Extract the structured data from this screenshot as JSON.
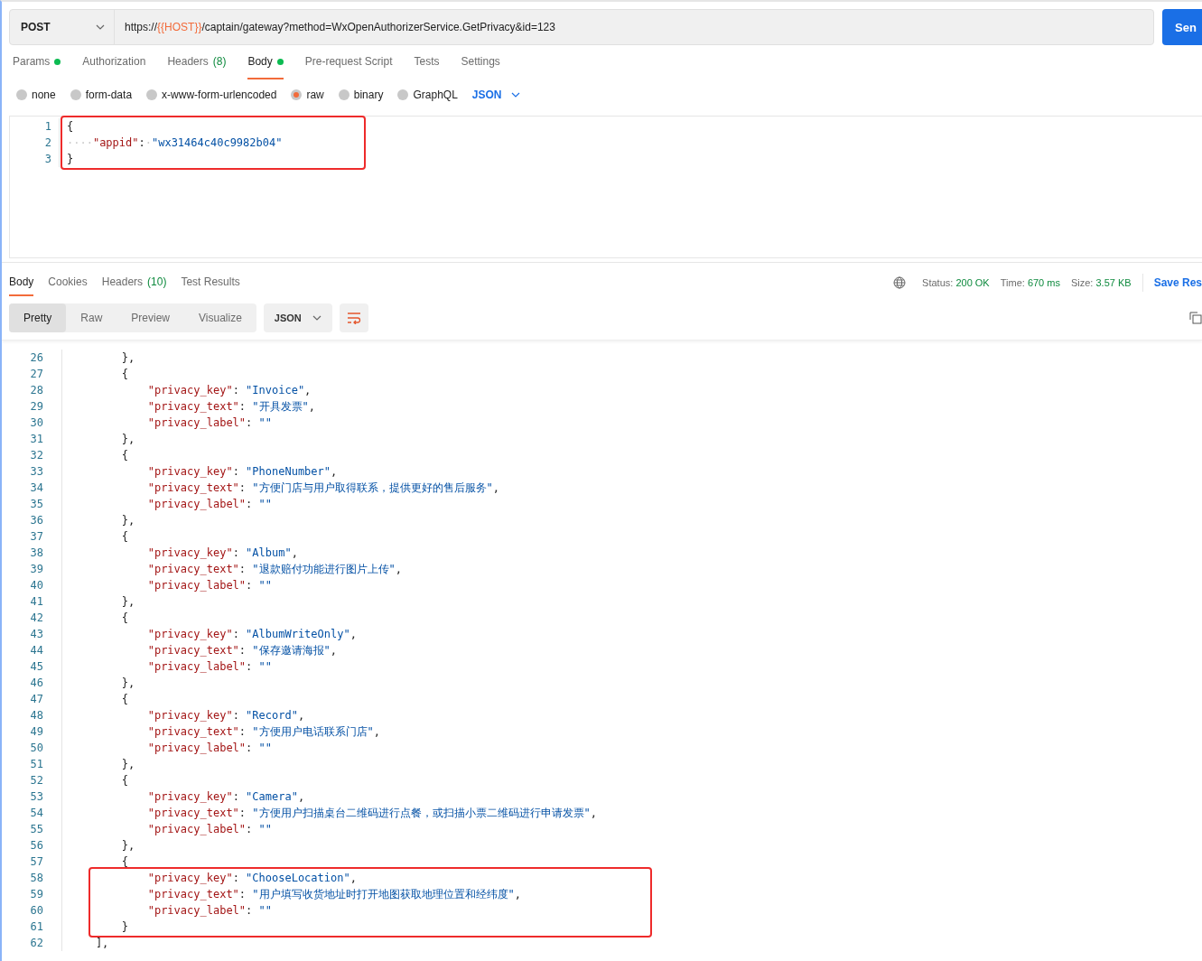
{
  "request": {
    "method": "POST",
    "url_parts": [
      {
        "kind": "plain",
        "text": "https://"
      },
      {
        "kind": "variable",
        "text": "{{HOST}}"
      },
      {
        "kind": "plain",
        "text": "/captain/gateway?method=WxOpenAuthorizerService.GetPrivacy&id=123"
      }
    ],
    "send_label": "Sen"
  },
  "request_tabs": [
    {
      "label": "Params",
      "dot": true,
      "selected": false
    },
    {
      "label": "Authorization",
      "dot": false,
      "selected": false
    },
    {
      "label": "Headers",
      "count": "(8)",
      "dot": false,
      "selected": false
    },
    {
      "label": "Body",
      "dot": true,
      "selected": true
    },
    {
      "label": "Pre-request Script",
      "dot": false,
      "selected": false
    },
    {
      "label": "Tests",
      "dot": false,
      "selected": false
    },
    {
      "label": "Settings",
      "dot": false,
      "selected": false
    }
  ],
  "body_types": [
    {
      "label": "none",
      "selected": false
    },
    {
      "label": "form-data",
      "selected": false
    },
    {
      "label": "x-www-form-urlencoded",
      "selected": false
    },
    {
      "label": "raw",
      "selected": true
    },
    {
      "label": "binary",
      "selected": false
    },
    {
      "label": "GraphQL",
      "selected": false
    }
  ],
  "body_format": "JSON",
  "request_body": [
    {
      "number": "1",
      "highlighted": true,
      "tokens": [
        {
          "kind": "punct",
          "text": "{"
        }
      ]
    },
    {
      "number": "2",
      "highlighted": true,
      "tokens": [
        {
          "kind": "space",
          "text": "····"
        },
        {
          "kind": "key",
          "text": "\"appid\""
        },
        {
          "kind": "punct",
          "text": ":"
        },
        {
          "kind": "space",
          "text": "·"
        },
        {
          "kind": "string",
          "text": "\"wx31464c40c9982b04\""
        }
      ]
    },
    {
      "number": "3",
      "highlighted": true,
      "tokens": [
        {
          "kind": "punct",
          "text": "}"
        }
      ]
    }
  ],
  "response_tabs": [
    {
      "label": "Body",
      "selected": true
    },
    {
      "label": "Cookies",
      "selected": false
    },
    {
      "label": "Headers",
      "count": "(10)",
      "selected": false
    },
    {
      "label": "Test Results",
      "selected": false
    }
  ],
  "response_meta": [
    {
      "label": "Status:",
      "value": "200 OK"
    },
    {
      "label": "Time:",
      "value": "670 ms"
    },
    {
      "label": "Size:",
      "value": "3.57 KB"
    }
  ],
  "save_label": "Save Res",
  "view_modes": [
    {
      "label": "Pretty",
      "selected": true
    },
    {
      "label": "Raw",
      "selected": false
    },
    {
      "label": "Preview",
      "selected": false
    },
    {
      "label": "Visualize",
      "selected": false
    }
  ],
  "response_format": "JSON",
  "response_body": [
    {
      "number": "26",
      "highlighted": false,
      "tokens": [
        {
          "kind": "punct",
          "text": "        },"
        }
      ]
    },
    {
      "number": "27",
      "highlighted": false,
      "tokens": [
        {
          "kind": "punct",
          "text": "        {"
        }
      ]
    },
    {
      "number": "28",
      "highlighted": false,
      "tokens": [
        {
          "kind": "key",
          "text": "            \"privacy_key\""
        },
        {
          "kind": "punct",
          "text": ": "
        },
        {
          "kind": "string",
          "text": "\"Invoice\""
        },
        {
          "kind": "punct",
          "text": ","
        }
      ]
    },
    {
      "number": "29",
      "highlighted": false,
      "tokens": [
        {
          "kind": "key",
          "text": "            \"privacy_text\""
        },
        {
          "kind": "punct",
          "text": ": "
        },
        {
          "kind": "string",
          "text": "\"开具发票\""
        },
        {
          "kind": "punct",
          "text": ","
        }
      ]
    },
    {
      "number": "30",
      "highlighted": false,
      "tokens": [
        {
          "kind": "key",
          "text": "            \"privacy_label\""
        },
        {
          "kind": "punct",
          "text": ": "
        },
        {
          "kind": "string",
          "text": "\"\""
        }
      ]
    },
    {
      "number": "31",
      "highlighted": false,
      "tokens": [
        {
          "kind": "punct",
          "text": "        },"
        }
      ]
    },
    {
      "number": "32",
      "highlighted": false,
      "tokens": [
        {
          "kind": "punct",
          "text": "        {"
        }
      ]
    },
    {
      "number": "33",
      "highlighted": false,
      "tokens": [
        {
          "kind": "key",
          "text": "            \"privacy_key\""
        },
        {
          "kind": "punct",
          "text": ": "
        },
        {
          "kind": "string",
          "text": "\"PhoneNumber\""
        },
        {
          "kind": "punct",
          "text": ","
        }
      ]
    },
    {
      "number": "34",
      "highlighted": false,
      "tokens": [
        {
          "kind": "key",
          "text": "            \"privacy_text\""
        },
        {
          "kind": "punct",
          "text": ": "
        },
        {
          "kind": "string",
          "text": "\"方便门店与用户取得联系，提供更好的售后服务\""
        },
        {
          "kind": "punct",
          "text": ","
        }
      ]
    },
    {
      "number": "35",
      "highlighted": false,
      "tokens": [
        {
          "kind": "key",
          "text": "            \"privacy_label\""
        },
        {
          "kind": "punct",
          "text": ": "
        },
        {
          "kind": "string",
          "text": "\"\""
        }
      ]
    },
    {
      "number": "36",
      "highlighted": false,
      "tokens": [
        {
          "kind": "punct",
          "text": "        },"
        }
      ]
    },
    {
      "number": "37",
      "highlighted": false,
      "tokens": [
        {
          "kind": "punct",
          "text": "        {"
        }
      ]
    },
    {
      "number": "38",
      "highlighted": false,
      "tokens": [
        {
          "kind": "key",
          "text": "            \"privacy_key\""
        },
        {
          "kind": "punct",
          "text": ": "
        },
        {
          "kind": "string",
          "text": "\"Album\""
        },
        {
          "kind": "punct",
          "text": ","
        }
      ]
    },
    {
      "number": "39",
      "highlighted": false,
      "tokens": [
        {
          "kind": "key",
          "text": "            \"privacy_text\""
        },
        {
          "kind": "punct",
          "text": ": "
        },
        {
          "kind": "string",
          "text": "\"退款赔付功能进行图片上传\""
        },
        {
          "kind": "punct",
          "text": ","
        }
      ]
    },
    {
      "number": "40",
      "highlighted": false,
      "tokens": [
        {
          "kind": "key",
          "text": "            \"privacy_label\""
        },
        {
          "kind": "punct",
          "text": ": "
        },
        {
          "kind": "string",
          "text": "\"\""
        }
      ]
    },
    {
      "number": "41",
      "highlighted": false,
      "tokens": [
        {
          "kind": "punct",
          "text": "        },"
        }
      ]
    },
    {
      "number": "42",
      "highlighted": false,
      "tokens": [
        {
          "kind": "punct",
          "text": "        {"
        }
      ]
    },
    {
      "number": "43",
      "highlighted": false,
      "tokens": [
        {
          "kind": "key",
          "text": "            \"privacy_key\""
        },
        {
          "kind": "punct",
          "text": ": "
        },
        {
          "kind": "string",
          "text": "\"AlbumWriteOnly\""
        },
        {
          "kind": "punct",
          "text": ","
        }
      ]
    },
    {
      "number": "44",
      "highlighted": false,
      "tokens": [
        {
          "kind": "key",
          "text": "            \"privacy_text\""
        },
        {
          "kind": "punct",
          "text": ": "
        },
        {
          "kind": "string",
          "text": "\"保存邀请海报\""
        },
        {
          "kind": "punct",
          "text": ","
        }
      ]
    },
    {
      "number": "45",
      "highlighted": false,
      "tokens": [
        {
          "kind": "key",
          "text": "            \"privacy_label\""
        },
        {
          "kind": "punct",
          "text": ": "
        },
        {
          "kind": "string",
          "text": "\"\""
        }
      ]
    },
    {
      "number": "46",
      "highlighted": false,
      "tokens": [
        {
          "kind": "punct",
          "text": "        },"
        }
      ]
    },
    {
      "number": "47",
      "highlighted": false,
      "tokens": [
        {
          "kind": "punct",
          "text": "        {"
        }
      ]
    },
    {
      "number": "48",
      "highlighted": false,
      "tokens": [
        {
          "kind": "key",
          "text": "            \"privacy_key\""
        },
        {
          "kind": "punct",
          "text": ": "
        },
        {
          "kind": "string",
          "text": "\"Record\""
        },
        {
          "kind": "punct",
          "text": ","
        }
      ]
    },
    {
      "number": "49",
      "highlighted": false,
      "tokens": [
        {
          "kind": "key",
          "text": "            \"privacy_text\""
        },
        {
          "kind": "punct",
          "text": ": "
        },
        {
          "kind": "string",
          "text": "\"方便用户电话联系门店\""
        },
        {
          "kind": "punct",
          "text": ","
        }
      ]
    },
    {
      "number": "50",
      "highlighted": false,
      "tokens": [
        {
          "kind": "key",
          "text": "            \"privacy_label\""
        },
        {
          "kind": "punct",
          "text": ": "
        },
        {
          "kind": "string",
          "text": "\"\""
        }
      ]
    },
    {
      "number": "51",
      "highlighted": false,
      "tokens": [
        {
          "kind": "punct",
          "text": "        },"
        }
      ]
    },
    {
      "number": "52",
      "highlighted": false,
      "tokens": [
        {
          "kind": "punct",
          "text": "        {"
        }
      ]
    },
    {
      "number": "53",
      "highlighted": false,
      "tokens": [
        {
          "kind": "key",
          "text": "            \"privacy_key\""
        },
        {
          "kind": "punct",
          "text": ": "
        },
        {
          "kind": "string",
          "text": "\"Camera\""
        },
        {
          "kind": "punct",
          "text": ","
        }
      ]
    },
    {
      "number": "54",
      "highlighted": false,
      "tokens": [
        {
          "kind": "key",
          "text": "            \"privacy_text\""
        },
        {
          "kind": "punct",
          "text": ": "
        },
        {
          "kind": "string",
          "text": "\"方便用户扫描桌台二维码进行点餐，或扫描小票二维码进行申请发票\""
        },
        {
          "kind": "punct",
          "text": ","
        }
      ]
    },
    {
      "number": "55",
      "highlighted": false,
      "tokens": [
        {
          "kind": "key",
          "text": "            \"privacy_label\""
        },
        {
          "kind": "punct",
          "text": ": "
        },
        {
          "kind": "string",
          "text": "\"\""
        }
      ]
    },
    {
      "number": "56",
      "highlighted": false,
      "tokens": [
        {
          "kind": "punct",
          "text": "        },"
        }
      ]
    },
    {
      "number": "57",
      "highlighted": false,
      "tokens": [
        {
          "kind": "punct",
          "text": "        {"
        }
      ]
    },
    {
      "number": "58",
      "highlighted": true,
      "tokens": [
        {
          "kind": "key",
          "text": "            \"privacy_key\""
        },
        {
          "kind": "punct",
          "text": ": "
        },
        {
          "kind": "string",
          "text": "\"ChooseLocation\""
        },
        {
          "kind": "punct",
          "text": ","
        }
      ]
    },
    {
      "number": "59",
      "highlighted": true,
      "tokens": [
        {
          "kind": "key",
          "text": "            \"privacy_text\""
        },
        {
          "kind": "punct",
          "text": ": "
        },
        {
          "kind": "string",
          "text": "\"用户填写收货地址时打开地图获取地理位置和经纬度\""
        },
        {
          "kind": "punct",
          "text": ","
        }
      ]
    },
    {
      "number": "60",
      "highlighted": true,
      "tokens": [
        {
          "kind": "key",
          "text": "            \"privacy_label\""
        },
        {
          "kind": "punct",
          "text": ": "
        },
        {
          "kind": "string",
          "text": "\"\""
        }
      ]
    },
    {
      "number": "61",
      "highlighted": true,
      "tokens": [
        {
          "kind": "punct",
          "text": "        }"
        }
      ]
    },
    {
      "number": "62",
      "highlighted": false,
      "tokens": [
        {
          "kind": "punct",
          "text": "    ],"
        }
      ]
    }
  ]
}
